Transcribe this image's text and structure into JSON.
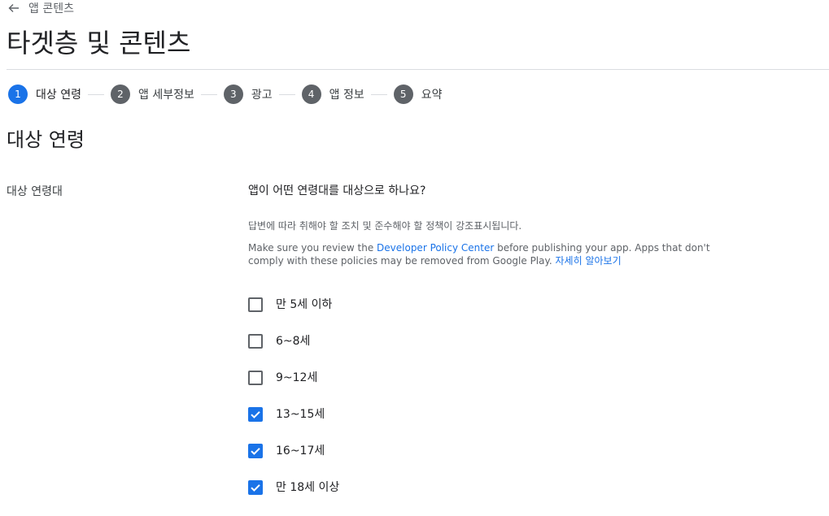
{
  "nav": {
    "back_label": "앱 콘텐츠"
  },
  "page": {
    "title": "타겟층 및 콘텐츠"
  },
  "stepper": {
    "steps": [
      {
        "number": "1",
        "label": "대상 연령",
        "active": true
      },
      {
        "number": "2",
        "label": "앱 세부정보",
        "active": false
      },
      {
        "number": "3",
        "label": "광고",
        "active": false
      },
      {
        "number": "4",
        "label": "앱 정보",
        "active": false
      },
      {
        "number": "5",
        "label": "요약",
        "active": false
      }
    ]
  },
  "section": {
    "title": "대상 연령",
    "field_label": "대상 연령대",
    "question": "앱이 어떤 연령대를 대상으로 하나요?",
    "hint": "답변에 따라 취해야 할 조치 및 준수해야 할 정책이 강조표시됩니다.",
    "policy": {
      "text_before": "Make sure you review the ",
      "link_policy": "Developer Policy Center",
      "text_after": " before publishing your app. Apps that don't comply with these policies may be removed from Google Play. ",
      "link_learn_more": "자세히 알아보기"
    },
    "age_options": [
      {
        "label": "만 5세 이하",
        "checked": false
      },
      {
        "label": "6~8세",
        "checked": false
      },
      {
        "label": "9~12세",
        "checked": false
      },
      {
        "label": "13~15세",
        "checked": true
      },
      {
        "label": "16~17세",
        "checked": true
      },
      {
        "label": "만 18세 이상",
        "checked": true
      }
    ]
  },
  "colors": {
    "accent": "#1a73e8",
    "inactive_step": "#5f6368",
    "divider": "#dadce0"
  }
}
